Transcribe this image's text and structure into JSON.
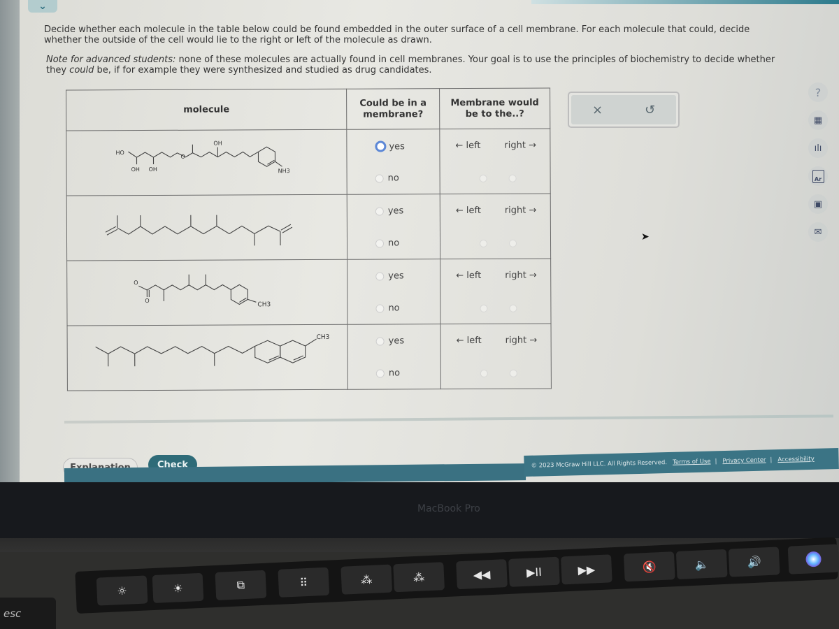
{
  "page": {
    "instructions": "Decide whether each molecule in the table below could be found embedded in the outer surface of a cell membrane. For each molecule that could, decide whether the outside of the cell would lie to the right or left of the molecule as drawn.",
    "note_prefix": "Note for advanced students:",
    "note_text_1": " none of these molecules are actually found in cell membranes. Your goal is to use the principles of biochemistry to decide whether they ",
    "note_emphasis": "could",
    "note_text_2": " be, if for example they were synthesized and studied as drug candidates."
  },
  "table": {
    "headers": {
      "molecule": "molecule",
      "membrane_line1": "Could be in a",
      "membrane_line2": "membrane?",
      "side_line1": "Membrane would",
      "side_line2": "be to the..?"
    },
    "rows": [
      {
        "molecule": "polyol ether chain with cyclohexenyl ammonium (HO, OH, OH, O, OH, NH3+)",
        "labels": {
          "ho": "HO",
          "oh1": "OH",
          "oh2": "OH",
          "o": "O",
          "oh3": "OH",
          "nh3": "NH3"
        },
        "yes": "yes",
        "no": "no",
        "left": "← left",
        "right": "right →",
        "membrane_answer": null,
        "side_answer": null,
        "focused": "yes"
      },
      {
        "molecule": "branched isoprenoid hydrocarbon diene",
        "labels": {},
        "yes": "yes",
        "no": "no",
        "left": "← left",
        "right": "right →",
        "membrane_answer": null,
        "side_answer": null
      },
      {
        "molecule": "carboxylate with branched chain and methylcyclohexenyl",
        "labels": {
          "o_minus": "O",
          "o": "O",
          "ch3": "CH3"
        },
        "yes": "yes",
        "no": "no",
        "left": "← left",
        "right": "right →",
        "membrane_answer": null,
        "side_answer": null
      },
      {
        "molecule": "branched alkyl chain with methyl-hexahydronaphthalene",
        "labels": {
          "ch3": "CH3"
        },
        "yes": "yes",
        "no": "no",
        "left": "← left",
        "right": "right →",
        "membrane_answer": null,
        "side_answer": null
      }
    ]
  },
  "actions": {
    "clear": "×",
    "reset": "↺"
  },
  "toolbar": [
    {
      "name": "help",
      "glyph": "?"
    },
    {
      "name": "calculator",
      "glyph": "▦"
    },
    {
      "name": "data",
      "glyph": "ılı"
    },
    {
      "name": "periodic-table",
      "glyph": "Ar"
    },
    {
      "name": "textbook",
      "glyph": "▣"
    },
    {
      "name": "message",
      "glyph": "✉"
    }
  ],
  "buttons": {
    "explanation": "Explanation",
    "check": "Check"
  },
  "footer": {
    "copyright": "© 2023 McGraw Hill LLC. All Rights Reserved.",
    "terms": "Terms of Use",
    "privacy": "Privacy Center",
    "accessibility": "Accessibility",
    "pipe": "|"
  },
  "device": {
    "brand": "MacBook Pro",
    "esc": "esc",
    "touchbar": [
      "☼",
      "☀",
      "⧉",
      "⠿",
      "⁂",
      "⁂",
      "◀◀",
      "▶II",
      "▶▶",
      "🔇",
      "🔈",
      "🔊"
    ]
  }
}
